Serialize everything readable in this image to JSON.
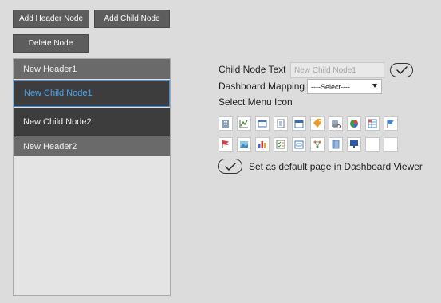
{
  "toolbar": {
    "add_header_label": "Add Header Node",
    "add_child_label": "Add Child Node",
    "delete_label": "Delete Node"
  },
  "tree": {
    "items": [
      {
        "label": "New Header1",
        "type": "header",
        "selected": false
      },
      {
        "label": "New Child Node1",
        "type": "child",
        "selected": true
      },
      {
        "label": "New Child Node2",
        "type": "child",
        "selected": false
      },
      {
        "label": "New Header2",
        "type": "header",
        "selected": false
      }
    ]
  },
  "form": {
    "child_node_text_label": "Child Node Text",
    "child_node_text_placeholder": "New Child Node1",
    "dashboard_mapping_label": "Dashboard Mapping",
    "dashboard_mapping_selected": "----Select----",
    "select_menu_icon_label": "Select Menu Icon",
    "default_page_label": "Set as default page in Dashboard Viewer"
  },
  "icons": [
    "building-icon",
    "line-chart-icon",
    "window-icon",
    "report-icon",
    "calendar-icon",
    "tag-icon",
    "database-icon",
    "pie-chart-icon",
    "spreadsheet-icon",
    "flag-icon",
    "red-flag-icon",
    "landscape-icon",
    "bar-chart-icon",
    "checklist-icon",
    "form-icon",
    "diagram-icon",
    "book-icon",
    "monitor-icon",
    "blank-icon"
  ],
  "colors": {
    "button_bg": "#5d5d5d",
    "header_bg": "#6a6a6a",
    "child_bg": "#3d3d3d",
    "selected_text": "#4aa3f0",
    "selected_border": "#3f8fd8"
  }
}
